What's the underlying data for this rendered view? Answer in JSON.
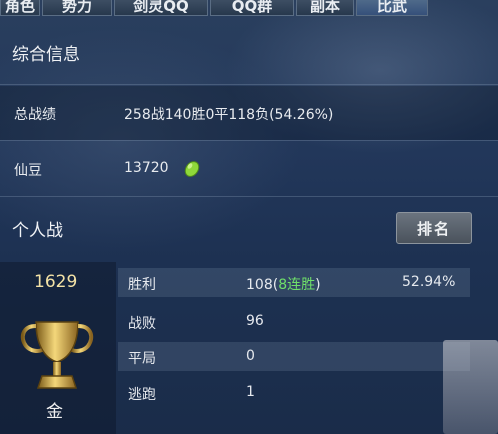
{
  "tabs": [
    {
      "label": "角色"
    },
    {
      "label": "势力"
    },
    {
      "label": "剑灵QQ"
    },
    {
      "label": "QQ群"
    },
    {
      "label": "副本"
    },
    {
      "label": "比武"
    }
  ],
  "overview": {
    "title": "综合信息",
    "record_label": "总战绩",
    "record_value": "258战140胜0平118负(54.26%)",
    "bean_label": "仙豆",
    "bean_value": "13720",
    "bean_icon": "green-bean-icon"
  },
  "personal": {
    "title": "个人战",
    "rank_button": "排名",
    "score": "1629",
    "medal": "金",
    "trophy_icon": "gold-trophy-icon",
    "rows": [
      {
        "label": "胜利",
        "value": "108(",
        "streak": "8连胜",
        "value_end": ")",
        "percent": "52.94%"
      },
      {
        "label": "战败",
        "value": "96"
      },
      {
        "label": "平局",
        "value": "0"
      },
      {
        "label": "逃跑",
        "value": "1"
      }
    ]
  },
  "colors": {
    "background": "#1e3250",
    "score": "#f3e2a6",
    "streak": "#6fe06a"
  }
}
